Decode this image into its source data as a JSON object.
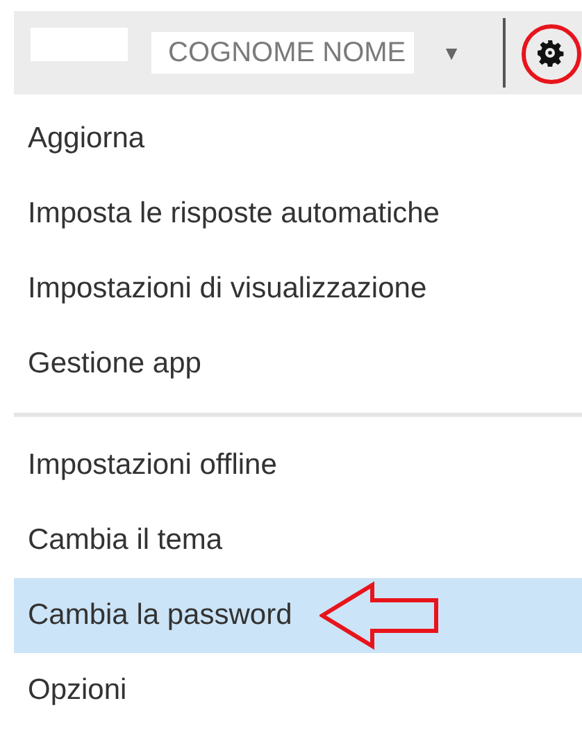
{
  "header": {
    "user_name": "COGNOME NOME",
    "user_menu_caret": "▼"
  },
  "menu_groups": [
    [
      {
        "label": "Aggiorna",
        "selected": false
      },
      {
        "label": "Imposta le risposte automatiche",
        "selected": false
      },
      {
        "label": "Impostazioni di visualizzazione",
        "selected": false
      },
      {
        "label": "Gestione app",
        "selected": false
      }
    ],
    [
      {
        "label": "Impostazioni offline",
        "selected": false
      },
      {
        "label": "Cambia il tema",
        "selected": false
      },
      {
        "label": "Cambia la password",
        "selected": true
      },
      {
        "label": "Opzioni",
        "selected": false
      }
    ]
  ]
}
